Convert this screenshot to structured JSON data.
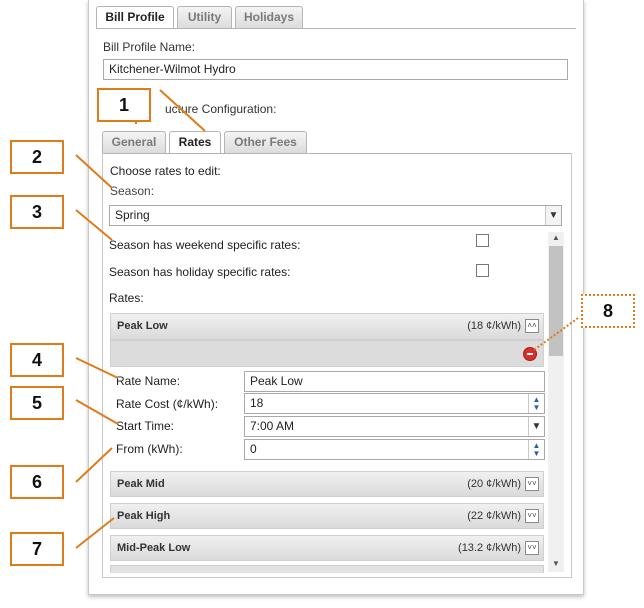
{
  "top_tabs": [
    "Bill Profile",
    "Utility",
    "Holidays"
  ],
  "bill_profile_name_label": "Bill Profile Name:",
  "bill_profile_name_value": "Kitchener-Wilmot Hydro",
  "structure_config_label": "ucture Configuration:",
  "sub_tabs": [
    "General",
    "Rates",
    "Other Fees"
  ],
  "choose_rates_label": "Choose rates to edit:",
  "season_label": "Season:",
  "season_value": "Spring",
  "weekend_label": "Season has weekend specific rates:",
  "holiday_label": "Season has holiday specific rates:",
  "rates_label": "Rates:",
  "rates": [
    {
      "name": "Peak Low",
      "rate": "(18 ¢/kWh)"
    },
    {
      "name": "Peak Mid",
      "rate": "(20 ¢/kWh)"
    },
    {
      "name": "Peak High",
      "rate": "(22 ¢/kWh)"
    },
    {
      "name": "Mid-Peak Low",
      "rate": "(13.2 ¢/kWh)"
    }
  ],
  "form": {
    "rate_name_label": "Rate Name:",
    "rate_name_value": "Peak Low",
    "rate_cost_label": "Rate Cost (¢/kWh):",
    "rate_cost_value": "18",
    "start_time_label": "Start Time:",
    "start_time_value": "7:00 AM",
    "from_label": "From (kWh):",
    "from_value": "0"
  },
  "callouts": [
    "1",
    "2",
    "3",
    "4",
    "5",
    "6",
    "7",
    "8"
  ],
  "colors": {
    "callout_border": "#e07b1a",
    "delete_icon": "#d9302c"
  }
}
